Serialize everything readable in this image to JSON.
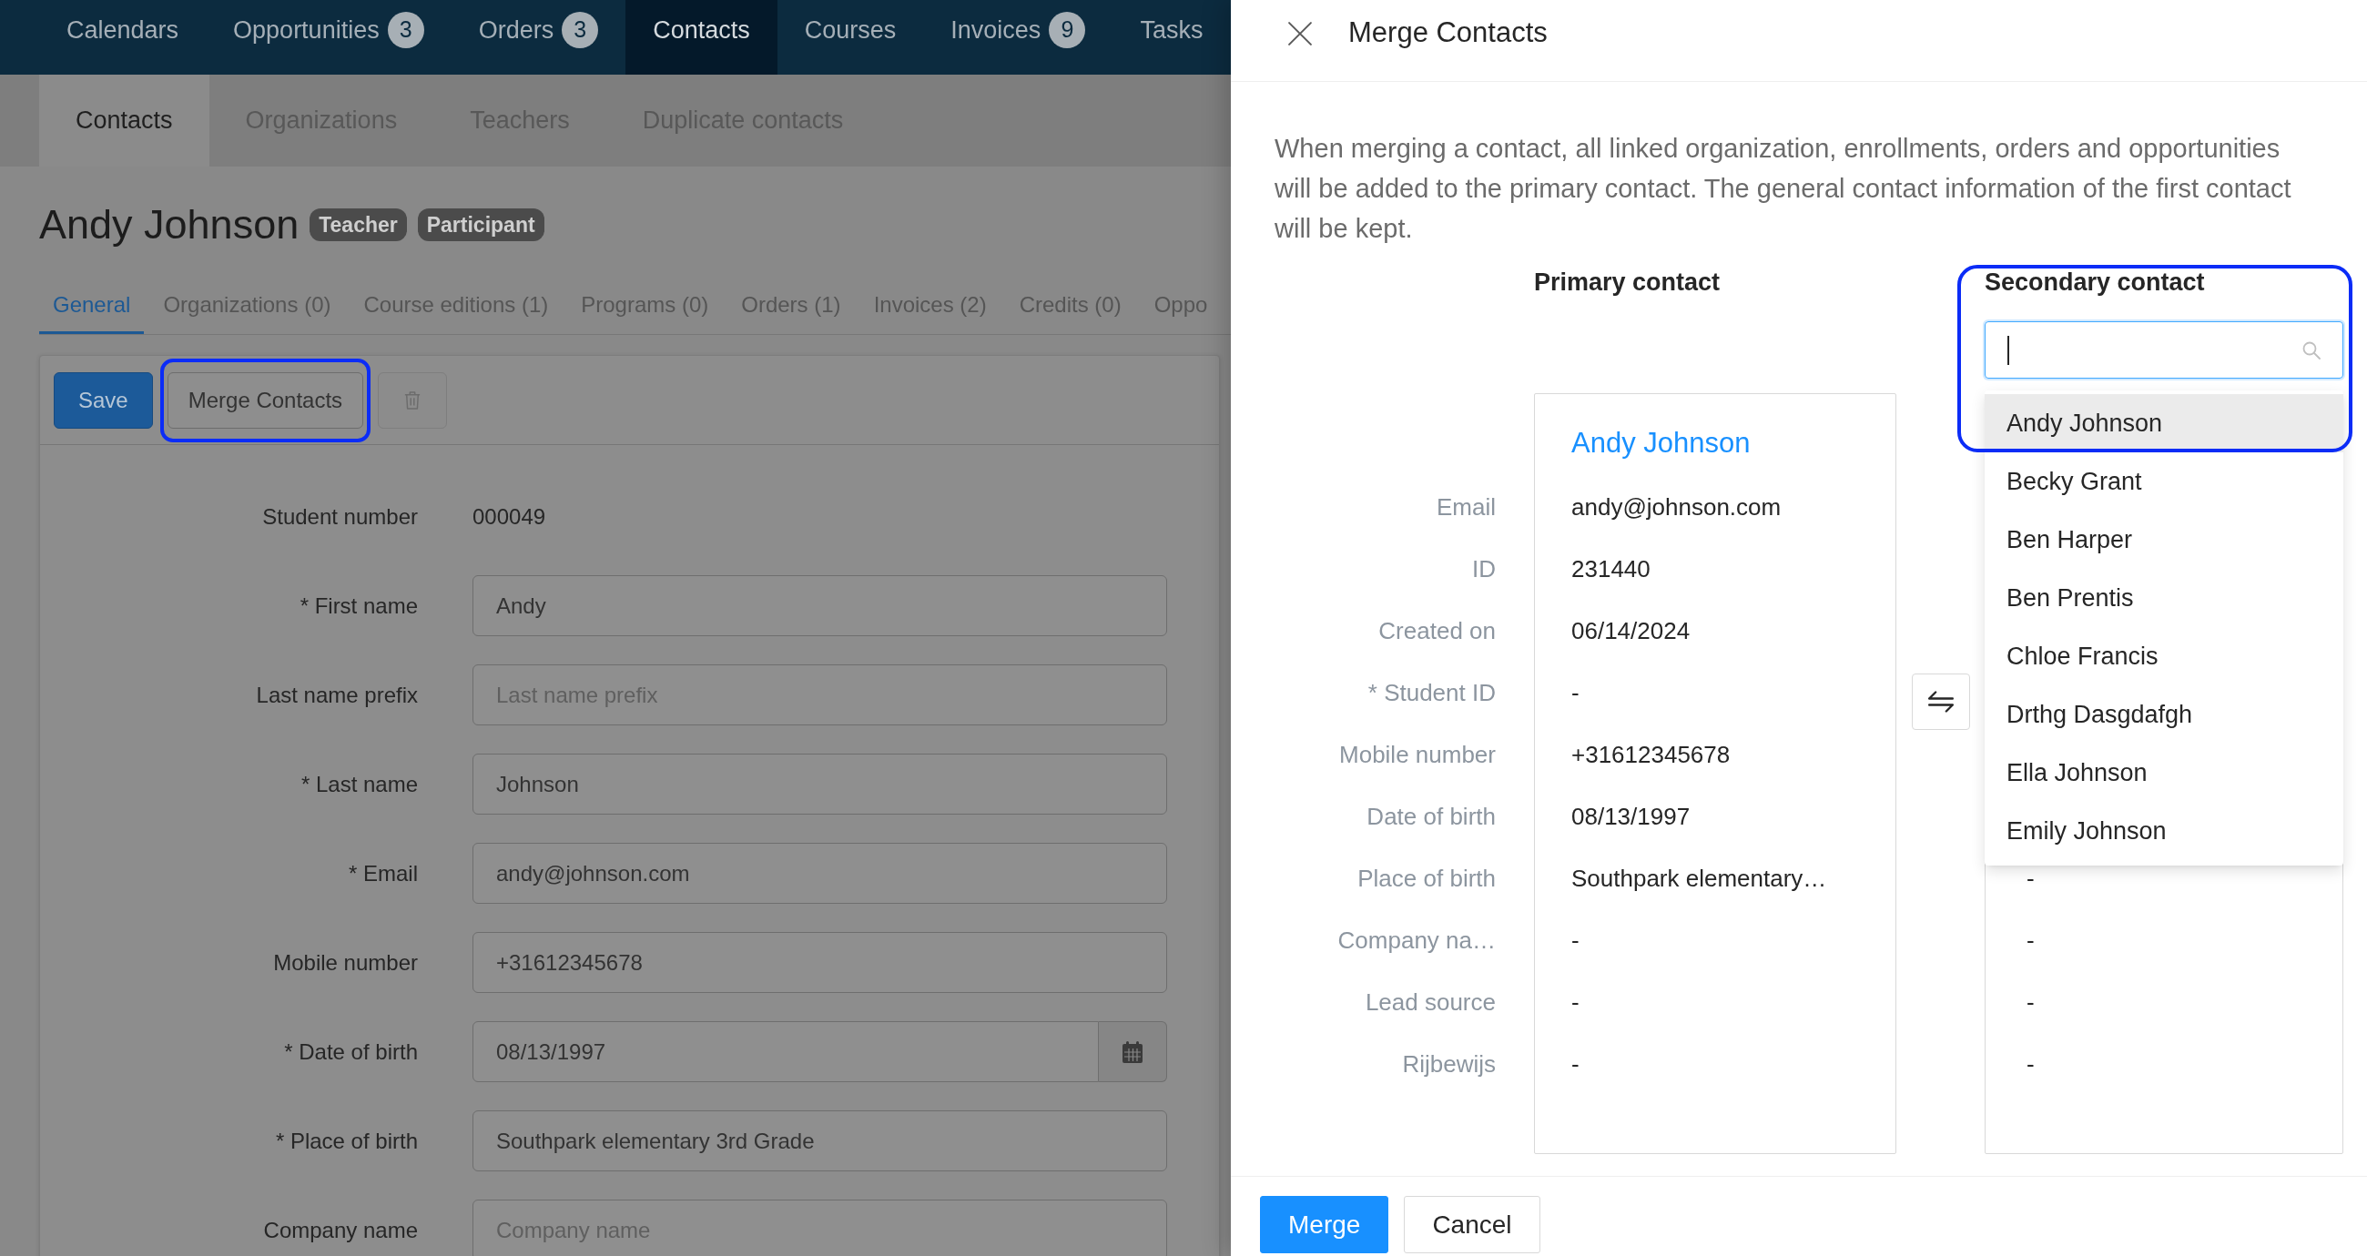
{
  "top_nav": [
    {
      "label": "Calendars",
      "selected": false
    },
    {
      "label": "Opportunities",
      "badge": "3",
      "selected": false
    },
    {
      "label": "Orders",
      "badge": "3",
      "selected": false
    },
    {
      "label": "Contacts",
      "selected": true
    },
    {
      "label": "Courses",
      "selected": false
    },
    {
      "label": "Invoices",
      "badge": "9",
      "selected": false
    },
    {
      "label": "Tasks",
      "selected": false
    }
  ],
  "sub_tabs": [
    {
      "label": "Contacts",
      "selected": true
    },
    {
      "label": "Organizations",
      "selected": false
    },
    {
      "label": "Teachers",
      "selected": false
    },
    {
      "label": "Duplicate contacts",
      "selected": false
    }
  ],
  "contact": {
    "name": "Andy Johnson",
    "badges": [
      "Teacher",
      "Participant"
    ]
  },
  "tabs": [
    {
      "label": "General",
      "selected": true
    },
    {
      "label": "Organizations (0)",
      "selected": false
    },
    {
      "label": "Course editions (1)",
      "selected": false
    },
    {
      "label": "Programs (0)",
      "selected": false
    },
    {
      "label": "Orders (1)",
      "selected": false
    },
    {
      "label": "Invoices (2)",
      "selected": false
    },
    {
      "label": "Credits (0)",
      "selected": false
    },
    {
      "label": "Oppo",
      "selected": false
    }
  ],
  "toolbar": [
    {
      "kind": "primary",
      "label": "Save",
      "highlighted": false,
      "disabled": false
    },
    {
      "kind": "default",
      "label": "Merge Contacts",
      "highlighted": true,
      "disabled": false
    },
    {
      "kind": "delete",
      "highlighted": false,
      "disabled": true
    }
  ],
  "form": [
    {
      "label": "Student number",
      "kind": "static",
      "value": "000049"
    },
    {
      "label": "* First name",
      "kind": "text",
      "value": "Andy"
    },
    {
      "label": "Last name prefix",
      "kind": "text",
      "placeholder": "Last name prefix"
    },
    {
      "label": "* Last name",
      "kind": "text",
      "value": "Johnson"
    },
    {
      "label": "* Email",
      "kind": "text",
      "value": "andy@johnson.com"
    },
    {
      "label": "Mobile number",
      "kind": "text",
      "value": "+31612345678"
    },
    {
      "label": "* Date of birth",
      "kind": "date",
      "value": "08/13/1997"
    },
    {
      "label": "* Place of birth",
      "kind": "text",
      "value": "Southpark elementary 3rd Grade"
    },
    {
      "label": "Company name",
      "kind": "text",
      "placeholder": "Company name"
    }
  ],
  "merge_drawer": {
    "title": "Merge Contacts",
    "description": "When merging a contact, all linked organization, enrollments, orders and opportunities will be added to the primary contact. The general contact information of the first contact will be kept.",
    "field_labels": [
      "Email",
      "ID",
      "Created on",
      "* Student ID",
      "Mobile number",
      "Date of birth",
      "Place of birth",
      "Company na…",
      "Lead source",
      "Rijbewijs"
    ],
    "primary_contact": {
      "heading": "Primary contact",
      "name": "Andy Johnson",
      "values": [
        "andy@johnson.com",
        "231440",
        "06/14/2024",
        "-",
        "+31612345678",
        "08/13/1997",
        "Southpark elementary…",
        "-",
        "-",
        "-"
      ]
    },
    "secondary_contact": {
      "heading": "Secondary contact",
      "highlighted": true,
      "search": {
        "focused": true
      },
      "options": [
        {
          "label": "Andy Johnson",
          "selected": true
        },
        {
          "label": "Becky Grant",
          "selected": false
        },
        {
          "label": "Ben Harper",
          "selected": false
        },
        {
          "label": "Ben Prentis",
          "selected": false
        },
        {
          "label": "Chloe Francis",
          "selected": false
        },
        {
          "label": "Drthg Dasgdafgh",
          "selected": false
        },
        {
          "label": "Ella Johnson",
          "selected": false
        },
        {
          "label": "Emily Johnson",
          "selected": false
        }
      ],
      "values": [
        "-",
        "-",
        "-",
        "-"
      ]
    },
    "buttons": [
      {
        "kind": "primary",
        "label": "Merge"
      },
      {
        "kind": "default",
        "label": "Cancel"
      }
    ]
  }
}
